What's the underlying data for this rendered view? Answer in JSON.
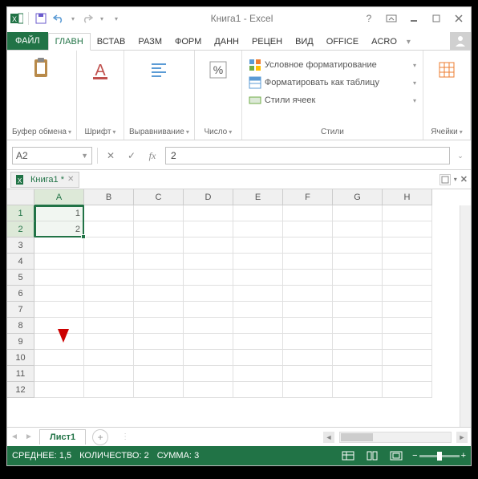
{
  "title": "Книга1 - Excel",
  "qat": {
    "save": "save",
    "undo": "undo",
    "redo": "redo"
  },
  "tabs": {
    "file": "ФАЙЛ",
    "list": [
      "ГЛАВН",
      "ВСТАВ",
      "РАЗМ",
      "ФОРМ",
      "ДАНН",
      "РЕЦЕН",
      "ВИД",
      "OFFICE",
      "ACRO"
    ],
    "active": 0
  },
  "ribbon": {
    "clipboard": {
      "label": "Буфер обмена"
    },
    "font": {
      "label": "Шрифт"
    },
    "align": {
      "label": "Выравнивание"
    },
    "number_g": {
      "label": "Число"
    },
    "styles_g": {
      "label": "Стили",
      "cond": "Условное форматирование",
      "table": "Форматировать как таблицу",
      "cellstyles": "Стили ячеек"
    },
    "cells_g": {
      "label": "Ячейки"
    }
  },
  "namebox": "A2",
  "formula": "2",
  "workbook_tab": "Книга1 *",
  "columns": [
    "A",
    "B",
    "C",
    "D",
    "E",
    "F",
    "G",
    "H"
  ],
  "rowcount": 12,
  "cells": {
    "A1": "1",
    "A2": "2"
  },
  "sheet": {
    "name": "Лист1"
  },
  "status": {
    "avg_lbl": "СРЕДНЕЕ:",
    "avg_val": "1,5",
    "count_lbl": "КОЛИЧЕСТВО:",
    "count_val": "2",
    "sum_lbl": "СУММА:",
    "sum_val": "3"
  },
  "chart_data": null
}
